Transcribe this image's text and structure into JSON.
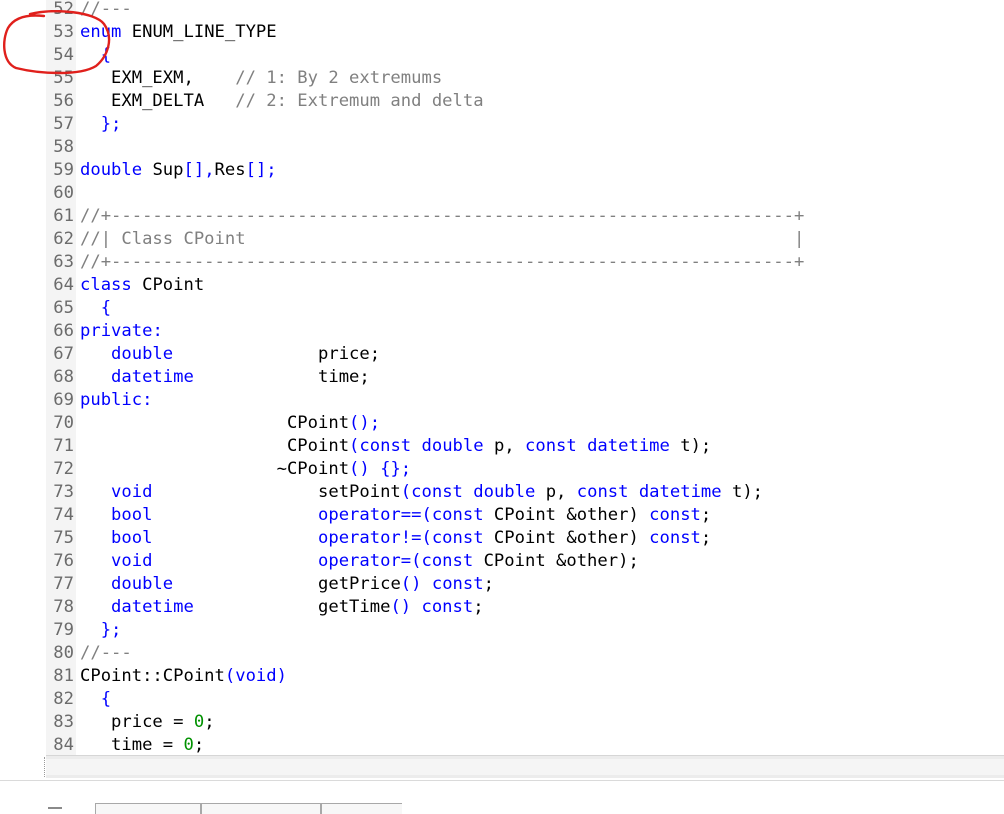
{
  "editor": {
    "colors": {
      "keyword": "#0000ff",
      "comment": "#808080",
      "number": "#009100",
      "text": "#000000",
      "line_number": "#6b6b6b",
      "annotation": "#e0201c"
    },
    "lines": [
      {
        "n": "52",
        "tokens": [
          {
            "t": "//---",
            "c": "com"
          }
        ]
      },
      {
        "n": "53",
        "tokens": [
          {
            "t": "enum",
            "c": "kw"
          },
          {
            "t": " ENUM_LINE_TYPE",
            "c": "id"
          }
        ]
      },
      {
        "n": "54",
        "tokens": [
          {
            "t": "  {",
            "c": "pun"
          }
        ]
      },
      {
        "n": "55",
        "tokens": [
          {
            "t": "   EXM_EXM,    ",
            "c": "id"
          },
          {
            "t": "// 1: By 2 extremums",
            "c": "com"
          }
        ]
      },
      {
        "n": "56",
        "tokens": [
          {
            "t": "   EXM_DELTA   ",
            "c": "id"
          },
          {
            "t": "// 2: Extremum and delta",
            "c": "com"
          }
        ]
      },
      {
        "n": "57",
        "tokens": [
          {
            "t": "  };",
            "c": "pun"
          }
        ]
      },
      {
        "n": "58",
        "tokens": []
      },
      {
        "n": "59",
        "tokens": [
          {
            "t": "double",
            "c": "kw"
          },
          {
            "t": " Sup",
            "c": "id"
          },
          {
            "t": "[],",
            "c": "pun"
          },
          {
            "t": "Res",
            "c": "id"
          },
          {
            "t": "[];",
            "c": "pun"
          }
        ]
      },
      {
        "n": "60",
        "tokens": []
      },
      {
        "n": "61",
        "tokens": [
          {
            "t": "//+------------------------------------------------------------------+",
            "c": "com"
          }
        ]
      },
      {
        "n": "62",
        "tokens": [
          {
            "t": "//| Class CPoint                                                     |",
            "c": "com"
          }
        ]
      },
      {
        "n": "63",
        "tokens": [
          {
            "t": "//+------------------------------------------------------------------+",
            "c": "com"
          }
        ]
      },
      {
        "n": "64",
        "tokens": [
          {
            "t": "class",
            "c": "kw"
          },
          {
            "t": " CPoint",
            "c": "id"
          }
        ]
      },
      {
        "n": "65",
        "tokens": [
          {
            "t": "  {",
            "c": "pun"
          }
        ]
      },
      {
        "n": "66",
        "tokens": [
          {
            "t": "private",
            "c": "kw"
          },
          {
            "t": ":",
            "c": "pun"
          }
        ]
      },
      {
        "n": "67",
        "tokens": [
          {
            "t": "   double",
            "c": "kw"
          },
          {
            "t": "              price;",
            "c": "id"
          }
        ]
      },
      {
        "n": "68",
        "tokens": [
          {
            "t": "   datetime",
            "c": "kw"
          },
          {
            "t": "            time;",
            "c": "id"
          }
        ]
      },
      {
        "n": "69",
        "tokens": [
          {
            "t": "public",
            "c": "kw"
          },
          {
            "t": ":",
            "c": "pun"
          }
        ]
      },
      {
        "n": "70",
        "tokens": [
          {
            "t": "                    CPoint",
            "c": "id"
          },
          {
            "t": "();",
            "c": "pun"
          }
        ]
      },
      {
        "n": "71",
        "tokens": [
          {
            "t": "                    CPoint",
            "c": "id"
          },
          {
            "t": "(",
            "c": "pun"
          },
          {
            "t": "const double",
            "c": "kw"
          },
          {
            "t": " p, ",
            "c": "id"
          },
          {
            "t": "const datetime",
            "c": "kw"
          },
          {
            "t": " t);",
            "c": "id"
          }
        ]
      },
      {
        "n": "72",
        "tokens": [
          {
            "t": "                   ~CPoint",
            "c": "id"
          },
          {
            "t": "() {};",
            "c": "pun"
          }
        ]
      },
      {
        "n": "73",
        "tokens": [
          {
            "t": "   void",
            "c": "kw"
          },
          {
            "t": "                setPoint",
            "c": "id"
          },
          {
            "t": "(",
            "c": "pun"
          },
          {
            "t": "const double",
            "c": "kw"
          },
          {
            "t": " p, ",
            "c": "id"
          },
          {
            "t": "const datetime",
            "c": "kw"
          },
          {
            "t": " t);",
            "c": "id"
          }
        ]
      },
      {
        "n": "74",
        "tokens": [
          {
            "t": "   bool",
            "c": "kw"
          },
          {
            "t": "                operator==(",
            "c": "kw"
          },
          {
            "t": "const",
            "c": "kw"
          },
          {
            "t": " CPoint &other) ",
            "c": "id"
          },
          {
            "t": "const",
            "c": "kw"
          },
          {
            "t": ";",
            "c": "id"
          }
        ]
      },
      {
        "n": "75",
        "tokens": [
          {
            "t": "   bool",
            "c": "kw"
          },
          {
            "t": "                operator!=(",
            "c": "kw"
          },
          {
            "t": "const",
            "c": "kw"
          },
          {
            "t": " CPoint &other) ",
            "c": "id"
          },
          {
            "t": "const",
            "c": "kw"
          },
          {
            "t": ";",
            "c": "id"
          }
        ]
      },
      {
        "n": "76",
        "tokens": [
          {
            "t": "   void",
            "c": "kw"
          },
          {
            "t": "                operator=(",
            "c": "kw"
          },
          {
            "t": "const",
            "c": "kw"
          },
          {
            "t": " CPoint &other);",
            "c": "id"
          }
        ]
      },
      {
        "n": "77",
        "tokens": [
          {
            "t": "   double",
            "c": "kw"
          },
          {
            "t": "              getPrice",
            "c": "id"
          },
          {
            "t": "() ",
            "c": "pun"
          },
          {
            "t": "const",
            "c": "kw"
          },
          {
            "t": ";",
            "c": "id"
          }
        ]
      },
      {
        "n": "78",
        "tokens": [
          {
            "t": "   datetime",
            "c": "kw"
          },
          {
            "t": "            getTime",
            "c": "id"
          },
          {
            "t": "() ",
            "c": "pun"
          },
          {
            "t": "const",
            "c": "kw"
          },
          {
            "t": ";",
            "c": "id"
          }
        ]
      },
      {
        "n": "79",
        "tokens": [
          {
            "t": "  };",
            "c": "pun"
          }
        ]
      },
      {
        "n": "80",
        "tokens": [
          {
            "t": "//---",
            "c": "com"
          }
        ]
      },
      {
        "n": "81",
        "tokens": [
          {
            "t": "CPoint::CPoint",
            "c": "id"
          },
          {
            "t": "(",
            "c": "pun"
          },
          {
            "t": "void",
            "c": "kw"
          },
          {
            "t": ")",
            "c": "pun"
          }
        ]
      },
      {
        "n": "82",
        "tokens": [
          {
            "t": "  {",
            "c": "pun"
          }
        ]
      },
      {
        "n": "83",
        "tokens": [
          {
            "t": "   price = ",
            "c": "id"
          },
          {
            "t": "0",
            "c": "num"
          },
          {
            "t": ";",
            "c": "id"
          }
        ]
      },
      {
        "n": "84",
        "tokens": [
          {
            "t": "   time = ",
            "c": "id"
          },
          {
            "t": "0",
            "c": "num"
          },
          {
            "t": ";",
            "c": "id"
          }
        ]
      }
    ]
  },
  "scrollbar": {
    "orientation": "horizontal"
  },
  "annotation": {
    "shape": "hand-drawn-circle",
    "note": ""
  }
}
